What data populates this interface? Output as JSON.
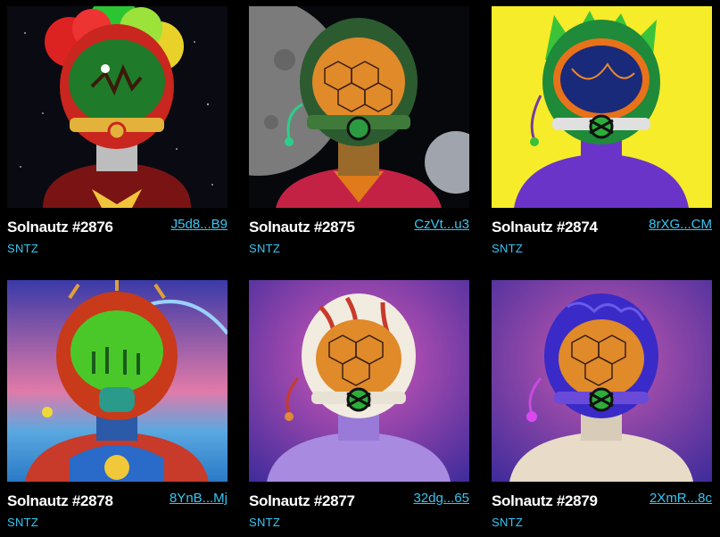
{
  "cards": [
    {
      "name": "Solnautz #2876",
      "address": "J5d8...B9",
      "symbol": "SNTZ",
      "art": "nft-art-green-afro-clown-helmet"
    },
    {
      "name": "Solnautz #2875",
      "address": "CzVt...u3",
      "symbol": "SNTZ",
      "art": "nft-art-moon-hexagon-visor"
    },
    {
      "name": "Solnautz #2874",
      "address": "8rXG...CM",
      "symbol": "SNTZ",
      "art": "nft-art-green-spiky-hair-yellow-bg"
    },
    {
      "name": "Solnautz #2878",
      "address": "8YnB...Mj",
      "symbol": "SNTZ",
      "art": "nft-art-red-helmet-forest-visor"
    },
    {
      "name": "Solnautz #2877",
      "address": "32dg...65",
      "symbol": "SNTZ",
      "art": "nft-art-striped-helmet-purple-body"
    },
    {
      "name": "Solnautz #2879",
      "address": "2XmR...8c",
      "symbol": "SNTZ",
      "art": "nft-art-brain-helmet-purple"
    }
  ],
  "colors": {
    "background": "#000000",
    "link": "#38c6f4",
    "text": "#ffffff"
  }
}
